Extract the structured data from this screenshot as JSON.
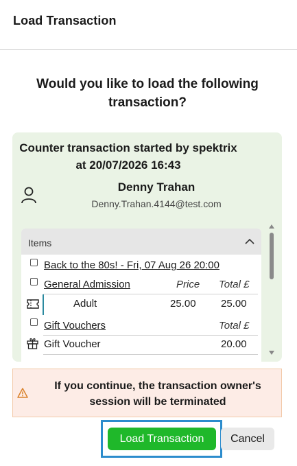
{
  "header": {
    "title": "Load Transaction"
  },
  "question": "Would you like to load the following transaction?",
  "transaction": {
    "title": "Counter transaction started by spektrix at 20/07/2026 16:43",
    "customer_name": "Denny Trahan",
    "customer_email": "Denny.Trahan.4144@test.com",
    "user_icon": "person-icon"
  },
  "items": {
    "header_label": "Items",
    "collapse_icon": "chevron-up-icon",
    "event": {
      "title": "Back to the 80s! - Fri, 07 Aug 26 20:00",
      "section": "General Admission",
      "price_header": "Price",
      "total_header": "Total £",
      "ticket_icon": "ticket-icon",
      "ticket_type": "Adult",
      "price": "25.00",
      "total": "25.00"
    },
    "vouchers": {
      "title": "Gift Vouchers",
      "total_header": "Total £",
      "gift_icon": "gift-icon",
      "item_name": "Gift Voucher",
      "total": "20.00"
    }
  },
  "warning": {
    "icon": "warning-icon",
    "text": "If you continue, the transaction owner's session will be terminated",
    "accent_color": "#d9822b"
  },
  "actions": {
    "load_label": "Load Transaction",
    "cancel_label": "Cancel",
    "primary_color": "#1fb82a"
  }
}
